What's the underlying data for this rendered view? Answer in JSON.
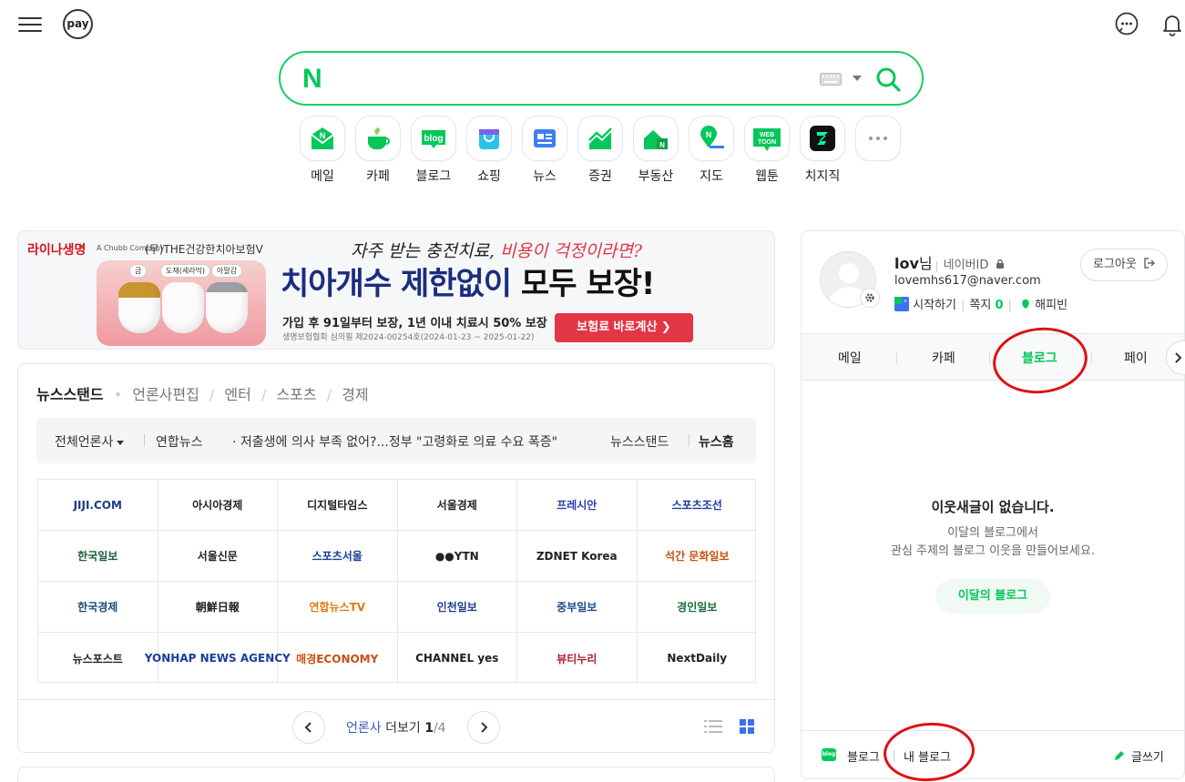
{
  "topbar": {
    "pay_label": "pay"
  },
  "search": {
    "placeholder": "",
    "logo": "N"
  },
  "shortcuts": [
    {
      "label": "메일",
      "icon": "mail-icon"
    },
    {
      "label": "카페",
      "icon": "cafe-icon"
    },
    {
      "label": "블로그",
      "icon": "blog-icon",
      "badge": "blog"
    },
    {
      "label": "쇼핑",
      "icon": "shopping-icon"
    },
    {
      "label": "뉴스",
      "icon": "news-icon"
    },
    {
      "label": "증권",
      "icon": "stock-icon"
    },
    {
      "label": "부동산",
      "icon": "realestate-icon"
    },
    {
      "label": "지도",
      "icon": "map-icon"
    },
    {
      "label": "웹툰",
      "icon": "webtoon-icon",
      "badge": "WEB TOON"
    },
    {
      "label": "치지직",
      "icon": "chzzk-icon"
    },
    {
      "label": "",
      "icon": "more-icon"
    }
  ],
  "ad": {
    "brand": "라이나생명",
    "brand_sub": "A Chubb Company",
    "brand_product": "(무)THE건강한치아보험V",
    "tags": [
      "금",
      "도재(세라믹)",
      "아말감"
    ],
    "headline_a": "자주 받는 충전치료,",
    "headline_b": " 비용이 걱정이라면?",
    "main_a": "치아개수 제한없이 ",
    "main_b": "모두 보장!",
    "sub": "가입 후 91일부터 보장, 1년 이내 치료시 50% 보장",
    "fine": "생명보험협회 심의필 제2024-00254호(2024-01-23 ~ 2025-01-22)",
    "cta": "보험료 바로계산 ❯"
  },
  "news": {
    "tabs": [
      "뉴스스탠드",
      "언론사편집",
      "엔터",
      "스포츠",
      "경제"
    ],
    "tab_dot": "•",
    "tab_sep": "/",
    "ticker_all": "전체언론사",
    "ticker_press": "연합뉴스",
    "ticker_headline": "· 저출생에 의사 부족 없어?...정부 \"고령화로 의료 수요 폭증\"",
    "ticker_link1": "뉴스스탠드",
    "ticker_link2": "뉴스홈",
    "grid": [
      [
        "JIJI.COM",
        "아시아경제",
        "디지털타임스",
        "서울경제",
        "프레시안",
        "스포츠조선"
      ],
      [
        "한국일보",
        "서울신문",
        "스포츠서울",
        "●●YTN",
        "ZDNET Korea",
        "석간 문화일보"
      ],
      [
        "한국경제",
        "朝鮮日報",
        "연합뉴스TV",
        "인천일보",
        "중부일보",
        "경인일보"
      ],
      [
        "뉴스포스트",
        "YONHAP NEWS AGENCY",
        "매경ECONOMY",
        "CHANNEL yes",
        "뷰티누리",
        "NextDaily"
      ]
    ],
    "grid_colors": [
      [
        "#1d3a8a",
        "#222",
        "#222",
        "#222",
        "#2b3fa8",
        "#1a3d9a"
      ],
      [
        "#1a5c3a",
        "#222",
        "#1a3d9a",
        "#222",
        "#222",
        "#c8500e"
      ],
      [
        "#1a4a7c",
        "#222",
        "#e07a0e",
        "#1b3d8c",
        "#1a4a8c",
        "#1a6b3a"
      ],
      [
        "#222",
        "#1a3d9a",
        "#c8500e",
        "#222",
        "#b02030",
        "#222"
      ]
    ],
    "pager_more": "언론사",
    "pager_more2": " 더보기 ",
    "pager_page": "1",
    "pager_total": "/4"
  },
  "side": {
    "user": "lov",
    "user_suffix": "님",
    "naver_id": "네이버ID",
    "email": "lovemhs617@naver.com",
    "start": "시작하기",
    "note": "쪽지",
    "note_count": "0",
    "happybean": "해피빈",
    "logout": "로그아웃",
    "tabs": [
      "메일",
      "카페",
      "블로그",
      "페이"
    ],
    "empty_title": "이웃새글이 없습니다.",
    "empty_desc1": "이달의 블로그에서",
    "empty_desc2": "관심 주제의 블로그 이웃을 만들어보세요.",
    "month_blog": "이달의 블로그",
    "foot_blog": "블로그",
    "foot_my": "내 블로그",
    "foot_write": "글쓰기"
  },
  "colors": {
    "brand": "#03c75a",
    "annotation": "#dd1111"
  }
}
